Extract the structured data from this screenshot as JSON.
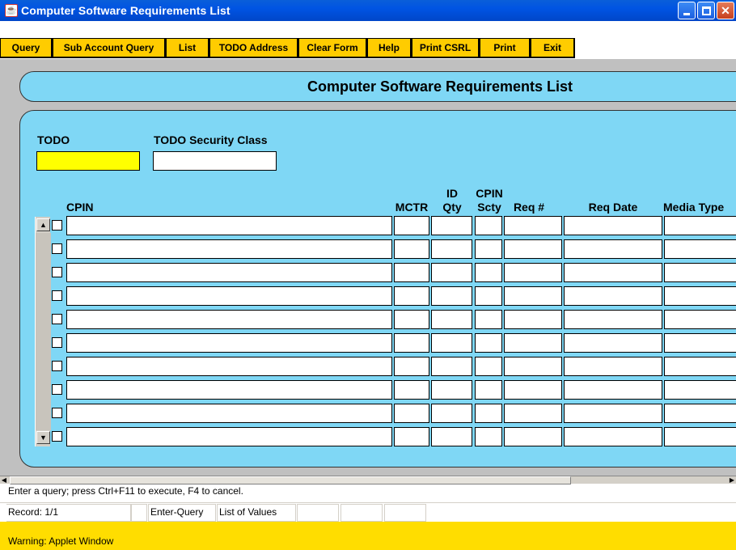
{
  "window": {
    "title": "Computer Software Requirements List"
  },
  "toolbar": {
    "buttons": [
      {
        "label": "Query"
      },
      {
        "label": "Sub Account Query"
      },
      {
        "label": "List"
      },
      {
        "label": "TODO Address"
      },
      {
        "label": "Clear Form"
      },
      {
        "label": "Help"
      },
      {
        "label": "Print CSRL"
      },
      {
        "label": "Print"
      },
      {
        "label": "Exit"
      }
    ]
  },
  "header": {
    "title": "Computer Software Requirements List"
  },
  "form": {
    "todo_label": "TODO",
    "todo_value": "",
    "todo_security_label": "TODO Security Class",
    "todo_security_value": ""
  },
  "table": {
    "columns": {
      "cpin": "CPIN",
      "mctr": "MCTR",
      "id_qty_top": "ID",
      "id_qty_bottom": "Qty",
      "cpin_scty_top": "CPIN",
      "cpin_scty_bottom": "Scty",
      "req_num": "Req #",
      "req_date": "Req Date",
      "media_type": "Media Type"
    },
    "row_count": 10
  },
  "status": {
    "message": "Enter a query;  press Ctrl+F11 to execute, F4 to cancel.",
    "record": "Record: 1/1",
    "mode": "Enter-Query",
    "lov": "List of Values"
  },
  "warning": {
    "text": "Warning: Applet Window"
  },
  "colors": {
    "titlebar": "#0054e3",
    "toolbar_button": "#ffcc00",
    "panel": "#7fd7f5",
    "workarea": "#c0c0c0",
    "todo_field": "#ffff00",
    "warning_bar": "#ffdd00"
  }
}
